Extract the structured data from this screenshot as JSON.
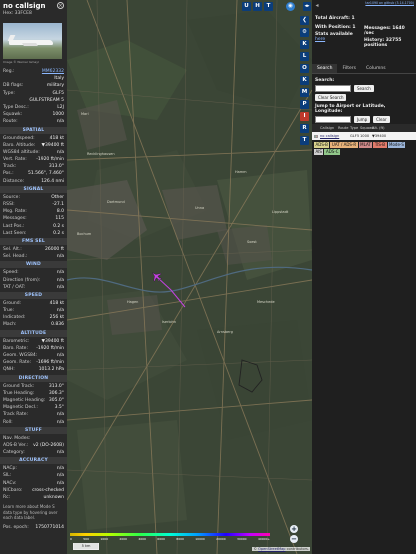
{
  "info_panel": {
    "callsign": "no callsign",
    "hex_label": "Hex: 33FCE8",
    "photo_credit": "Image © Werner Ismayl",
    "fields_top": [
      {
        "k": "Reg.:",
        "v": "MM62332",
        "link": true
      },
      {
        "k": "",
        "v": "Italy"
      },
      {
        "k": "DB flags:",
        "v": "military"
      },
      {
        "k": "Type:",
        "v": "GLF5"
      },
      {
        "k": "",
        "v": "GULFSTREAM 5"
      },
      {
        "k": "Type Desc.:",
        "v": "L2J"
      },
      {
        "k": "Squawk:",
        "v": "1000"
      },
      {
        "k": "Route:",
        "v": "n/a"
      }
    ],
    "section_spatial": "SPATIAL",
    "fields_spatial": [
      {
        "k": "Groundspeed:",
        "v": "418 kt"
      },
      {
        "k": "Baro. Altitude:",
        "v": "▼39400 ft"
      },
      {
        "k": "WGS84 altitude:",
        "v": "n/a"
      },
      {
        "k": "Vert. Rate:",
        "v": "-1920 ft/min"
      },
      {
        "k": "Track:",
        "v": "313.0°"
      },
      {
        "k": "Pos.:",
        "v": "51.566°, 7.460°"
      },
      {
        "k": "Distance:",
        "v": "126.4 nmi"
      }
    ],
    "section_signal": "SIGNAL",
    "fields_signal": [
      {
        "k": "Source:",
        "v": "Other"
      },
      {
        "k": "RSSI:",
        "v": "-27.1"
      },
      {
        "k": "Msg. Rate:",
        "v": "8.0"
      },
      {
        "k": "Messages:",
        "v": "115"
      },
      {
        "k": "Last Pos.:",
        "v": "0.2 s"
      },
      {
        "k": "Last Seen:",
        "v": "0.2 s"
      }
    ],
    "section_fms": "FMS SEL",
    "fields_fms": [
      {
        "k": "Sel. Alt.:",
        "v": "26000 ft"
      },
      {
        "k": "Sel. Head.:",
        "v": "n/a"
      }
    ],
    "section_wind": "WIND",
    "fields_wind": [
      {
        "k": "Speed:",
        "v": "n/a"
      },
      {
        "k": "Direction (from):",
        "v": "n/a"
      },
      {
        "k": "TAT / OAT:",
        "v": "n/a"
      }
    ],
    "section_speed": "SPEED",
    "fields_speed": [
      {
        "k": "Ground:",
        "v": "418 kt"
      },
      {
        "k": "True:",
        "v": "n/a"
      },
      {
        "k": "Indicated:",
        "v": "256 kt"
      },
      {
        "k": "Mach:",
        "v": "0.836"
      }
    ],
    "section_altitude": "ALTITUDE",
    "fields_altitude": [
      {
        "k": "Barometric:",
        "v": "▼39400 ft"
      },
      {
        "k": "Baro. Rate:",
        "v": "-1920 ft/min"
      },
      {
        "k": "Geom. WGS84:",
        "v": "n/a"
      },
      {
        "k": "Geom. Rate:",
        "v": "-1696 ft/min"
      },
      {
        "k": "QNH:",
        "v": "1013.2 hPa"
      }
    ],
    "section_direction": "DIRECTION",
    "fields_direction": [
      {
        "k": "Ground Track:",
        "v": "313.0°"
      },
      {
        "k": "True Heading:",
        "v": "306.3°"
      },
      {
        "k": "Magnetic Heading:",
        "v": "305.0°"
      },
      {
        "k": "Magnetic Decl.:",
        "v": "3.5°"
      },
      {
        "k": "Track Rate:",
        "v": "n/a"
      },
      {
        "k": "Roll:",
        "v": "n/a"
      }
    ],
    "section_stuff": "STUFF",
    "fields_stuff": [
      {
        "k": "Nav. Modes:",
        "v": ""
      },
      {
        "k": "ADS-B Ver.:",
        "v": "v2 (DO-260B)"
      },
      {
        "k": "Category:",
        "v": "n/a"
      }
    ],
    "section_accuracy": "ACCURACY",
    "fields_accuracy": [
      {
        "k": "NACp:",
        "v": "n/a"
      },
      {
        "k": "SIL:",
        "v": "n/a"
      },
      {
        "k": "NACv:",
        "v": "n/a"
      },
      {
        "k": "NICbaro:",
        "v": "cross-checked"
      },
      {
        "k": "Rc:",
        "v": "unknown"
      }
    ],
    "note": "Learn more about Mode S data type by hovering over each data label.",
    "pos_epoch_label": "Pos. epoch:",
    "pos_epoch_value": "1750771014"
  },
  "map": {
    "buttons_top": [
      "U",
      "H",
      "T"
    ],
    "buttons_side": [
      "K",
      "L",
      "O",
      "K",
      "M",
      "P",
      "I",
      "R",
      "T"
    ],
    "place_labels": [
      "Marl",
      "Recklinghausen",
      "Dortmund",
      "Unna",
      "Hamm",
      "Bochum",
      "Hagen",
      "Soest",
      "Lippstadt",
      "Arnsberg",
      "Iserlohn",
      "Meschede"
    ],
    "legend_labels": [
      "0",
      "500",
      "1000",
      "2000",
      "4000",
      "6000",
      "8000",
      "10000",
      "20000",
      "30000",
      "40000+"
    ],
    "scale_text": "5 km",
    "attribution_prefix": "© ",
    "attribution_link": "OpenStreetMap",
    "attribution_suffix": " contributors.",
    "zoom_in": "+",
    "zoom_out": "−"
  },
  "right_panel": {
    "version_link": "tar1090 on github (3.14.1700)",
    "total_aircraft": "Total Aircraft: 1",
    "with_position": "With Position: 1",
    "stats_available": "Stats available",
    "stats_link": "here",
    "messages": "Messages: 1640 /sec",
    "history": "History: 32755 positions",
    "tabs": [
      "Search",
      "Filters",
      "Columns"
    ],
    "search_label": "Search:",
    "search_button": "Search",
    "clear_search": "Clear Search",
    "jump_label": "Jump to Airport or Latitude, Longitude:",
    "jump_button": "Jump",
    "clear_button": "Clear",
    "table_headers": [
      "",
      "Callsign",
      "Route",
      "Type",
      "Squawk",
      "Alt. (ft)"
    ],
    "table_row": [
      "",
      "no callsign",
      "",
      "GLF5",
      "1000",
      "▼39400"
    ],
    "source_legend": [
      {
        "label": "ADS-B",
        "color": "#d9d28c"
      },
      {
        "label": "UAT / ADS-R",
        "color": "#e8b27a"
      },
      {
        "label": "MLAT",
        "color": "#d18a8a"
      },
      {
        "label": "TIS-B",
        "color": "#e27b6b"
      },
      {
        "label": "Mode-S",
        "color": "#9bb5d9"
      },
      {
        "label": "AIS",
        "color": "#cfcfcf"
      },
      {
        "label": "ADS-C",
        "color": "#91c78a"
      }
    ]
  },
  "colors": {
    "accent": "#8cb8ff",
    "aircraft": "#c342e0",
    "map_bg": "#3b4636"
  }
}
